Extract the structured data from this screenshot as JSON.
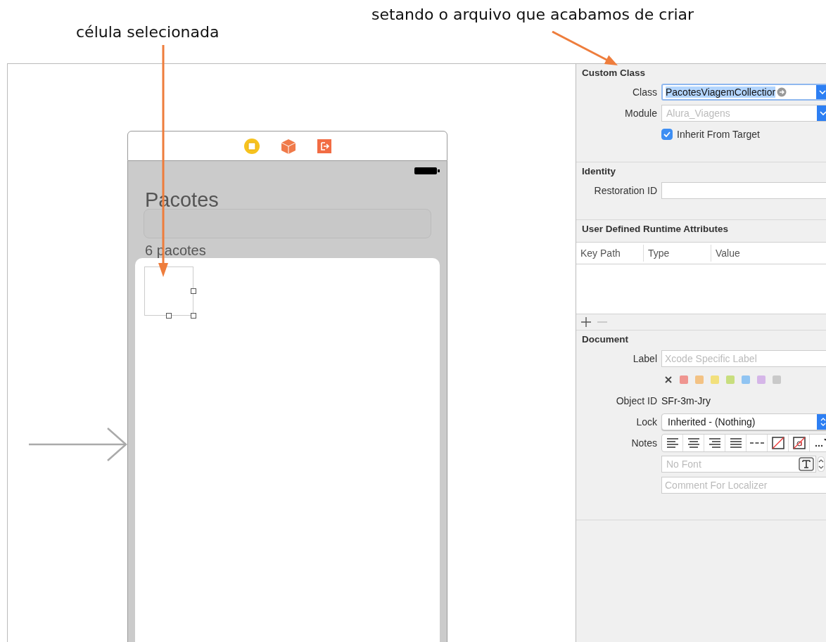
{
  "annotations": [
    {
      "text": "célula selecionada"
    },
    {
      "text": "setando o arquivo que acabamos de criar"
    }
  ],
  "scene": {
    "title": "Pacotes",
    "subtitle": "6 pacotes",
    "cell_selected": true
  },
  "inspector": {
    "custom_class": {
      "heading": "Custom Class",
      "class_label": "Class",
      "class_value": "PacotesViagemCollectior",
      "module_label": "Module",
      "module_placeholder": "Alura_Viagens",
      "inherit_label": "Inherit From Target",
      "inherit_checked": true
    },
    "identity": {
      "heading": "Identity",
      "restoration_label": "Restoration ID"
    },
    "runtime_attributes": {
      "heading": "User Defined Runtime Attributes",
      "columns": [
        "Key Path",
        "Type",
        "Value"
      ]
    },
    "document": {
      "heading": "Document",
      "label_label": "Label",
      "label_placeholder": "Xcode Specific Label",
      "label_colors": [
        {
          "color": "#ef9590"
        },
        {
          "color": "#f3c284"
        },
        {
          "color": "#f2e07c"
        },
        {
          "color": "#c8de7e"
        },
        {
          "color": "#90c4f2"
        },
        {
          "color": "#d5b6e8"
        },
        {
          "color": "#c9c9c9"
        }
      ],
      "object_id_label": "Object ID",
      "object_id": "SFr-3m-Jry",
      "lock_label": "Lock",
      "lock_value": "Inherited - (Nothing)",
      "notes_label": "Notes",
      "font_placeholder": "No Font",
      "comment_placeholder": "Comment For Localizer"
    }
  }
}
